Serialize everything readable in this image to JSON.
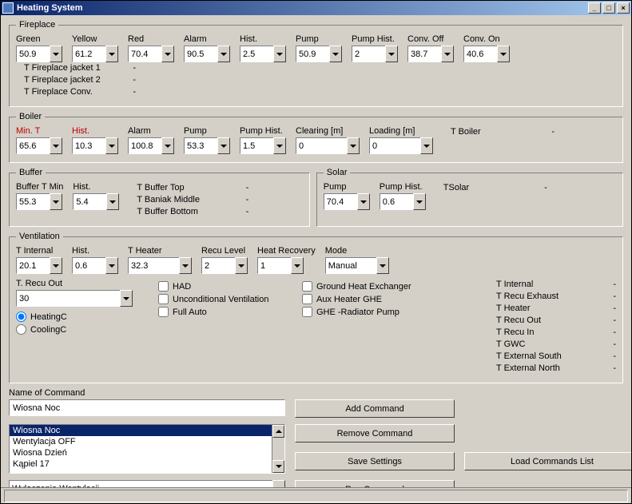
{
  "window": {
    "title": "Heating System"
  },
  "fireplace": {
    "legend": "Fireplace",
    "fields": [
      {
        "label": "Green",
        "value": "50.9"
      },
      {
        "label": "Yellow",
        "value": "61.2"
      },
      {
        "label": "Red",
        "value": "70.4"
      },
      {
        "label": "Alarm",
        "value": "90.5"
      },
      {
        "label": "Hist.",
        "value": "2.5"
      },
      {
        "label": "Pump",
        "value": "50.9"
      },
      {
        "label": "Pump Hist.",
        "value": "2"
      },
      {
        "label": "Conv. Off",
        "value": "38.7"
      },
      {
        "label": "Conv. On",
        "value": "40.6"
      }
    ],
    "status": [
      {
        "label": "T Fireplace jacket 1",
        "value": "-"
      },
      {
        "label": "T Fireplace jacket 2",
        "value": "-"
      },
      {
        "label": "T Fireplace Conv.",
        "value": "-"
      }
    ]
  },
  "boiler": {
    "legend": "Boiler",
    "fields": [
      {
        "label": "Min. T",
        "value": "65.6",
        "red": true
      },
      {
        "label": "Hist.",
        "value": "10.3",
        "red": true
      },
      {
        "label": "Alarm",
        "value": "100.8"
      },
      {
        "label": "Pump",
        "value": "53.3"
      },
      {
        "label": "Pump Hist.",
        "value": "1.5"
      },
      {
        "label": "Clearing [m]",
        "value": "0"
      },
      {
        "label": "Loading [m]",
        "value": "0"
      }
    ],
    "status": [
      {
        "label": "T Boiler",
        "value": "-"
      }
    ]
  },
  "buffer": {
    "legend": "Buffer",
    "fields": [
      {
        "label": "Buffer T Min",
        "value": "55.3"
      },
      {
        "label": "Hist.",
        "value": "5.4"
      }
    ],
    "status": [
      {
        "label": "T Buffer Top",
        "value": "-"
      },
      {
        "label": "T Baniak Middle",
        "value": "-"
      },
      {
        "label": "T Buffer Bottom",
        "value": "-"
      }
    ]
  },
  "solar": {
    "legend": "Solar",
    "fields": [
      {
        "label": "Pump",
        "value": "70.4"
      },
      {
        "label": "Pump Hist.",
        "value": "0.6"
      }
    ],
    "status": [
      {
        "label": "TSolar",
        "value": "-"
      }
    ]
  },
  "ventilation": {
    "legend": "Ventilation",
    "fields": [
      {
        "label": "T Internal",
        "value": "20.1"
      },
      {
        "label": "Hist.",
        "value": "0.6"
      },
      {
        "label": "T Heater",
        "value": "32.3",
        "wide": true
      },
      {
        "label": "Recu Level",
        "value": "2"
      },
      {
        "label": "Heat Recovery",
        "value": "1"
      },
      {
        "label": "Mode",
        "value": "Manual"
      }
    ],
    "recu_out": {
      "label": "T. Recu Out",
      "value": "30"
    },
    "checks_col1": [
      {
        "label": "HAD"
      },
      {
        "label": "Unconditional Ventilation"
      },
      {
        "label": "Full Auto"
      }
    ],
    "checks_col2": [
      {
        "label": "Ground Heat Exchanger"
      },
      {
        "label": "Aux Heater GHE"
      },
      {
        "label": "GHE -Radiator Pump"
      }
    ],
    "radios": [
      {
        "label": "HeatingC",
        "checked": true
      },
      {
        "label": "CoolingC",
        "checked": false
      }
    ],
    "status": [
      {
        "label": "T Internal",
        "value": "-"
      },
      {
        "label": "T Recu Exhaust",
        "value": "-"
      },
      {
        "label": "T Heater",
        "value": "-"
      },
      {
        "label": "T Recu Out",
        "value": "-"
      },
      {
        "label": "T Recu In",
        "value": "-"
      },
      {
        "label": "T GWC",
        "value": "-"
      },
      {
        "label": "T External South",
        "value": "-"
      },
      {
        "label": "T External North",
        "value": "-"
      }
    ]
  },
  "commands": {
    "name_label": "Name of Command",
    "name_value": "Wiosna Noc",
    "add": "Add Command",
    "remove": "Remove Command",
    "save": "Save Settings",
    "load": "Load Commands List",
    "run": "Run Command",
    "list": [
      "Wiosna Noc",
      "Wentylacja OFF",
      "Wiosna Dzień",
      "Kąpiel 17"
    ],
    "selected_index": 0,
    "run_combo": "Wyłączenie Wentylacji"
  }
}
